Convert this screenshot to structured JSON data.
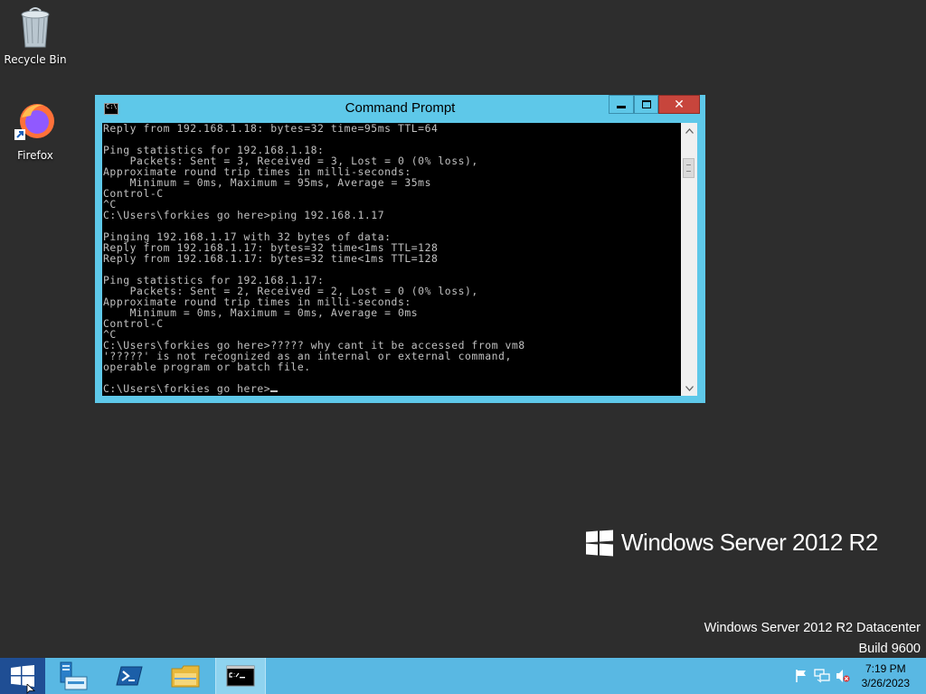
{
  "desktop": {
    "icons": [
      {
        "label": "Recycle Bin",
        "icon": "recycle-bin-icon"
      },
      {
        "label": "Firefox",
        "icon": "firefox-icon"
      }
    ],
    "branding": "Windows Server 2012 R2",
    "edition_line1": "Windows Server 2012 R2 Datacenter",
    "edition_line2": "Build 9600"
  },
  "window": {
    "title": "Command Prompt",
    "icon": "cmd-icon",
    "close_glyph": "✕",
    "console_lines": [
      "Reply from 192.168.1.18: bytes=32 time=95ms TTL=64",
      "",
      "Ping statistics for 192.168.1.18:",
      "    Packets: Sent = 3, Received = 3, Lost = 0 (0% loss),",
      "Approximate round trip times in milli-seconds:",
      "    Minimum = 0ms, Maximum = 95ms, Average = 35ms",
      "Control-C",
      "^C",
      "C:\\Users\\forkies go here>ping 192.168.1.17",
      "",
      "Pinging 192.168.1.17 with 32 bytes of data:",
      "Reply from 192.168.1.17: bytes=32 time<1ms TTL=128",
      "Reply from 192.168.1.17: bytes=32 time<1ms TTL=128",
      "",
      "Ping statistics for 192.168.1.17:",
      "    Packets: Sent = 2, Received = 2, Lost = 0 (0% loss),",
      "Approximate round trip times in milli-seconds:",
      "    Minimum = 0ms, Maximum = 0ms, Average = 0ms",
      "Control-C",
      "^C",
      "C:\\Users\\forkies go here>????? why cant it be accessed from vm8",
      "'?????' is not recognized as an internal or external command,",
      "operable program or batch file.",
      ""
    ],
    "prompt": "C:\\Users\\forkies go here>"
  },
  "taskbar": {
    "items": [
      {
        "name": "server-manager-icon"
      },
      {
        "name": "powershell-icon"
      },
      {
        "name": "file-explorer-icon"
      },
      {
        "name": "command-prompt-icon",
        "active": true
      }
    ],
    "clock_time": "7:19 PM",
    "clock_date": "3/26/2023"
  },
  "colors": {
    "window_frame": "#5ec8e9",
    "taskbar": "#59b8e3",
    "desktop": "#2d2d2d",
    "close_button": "#c7453c"
  }
}
